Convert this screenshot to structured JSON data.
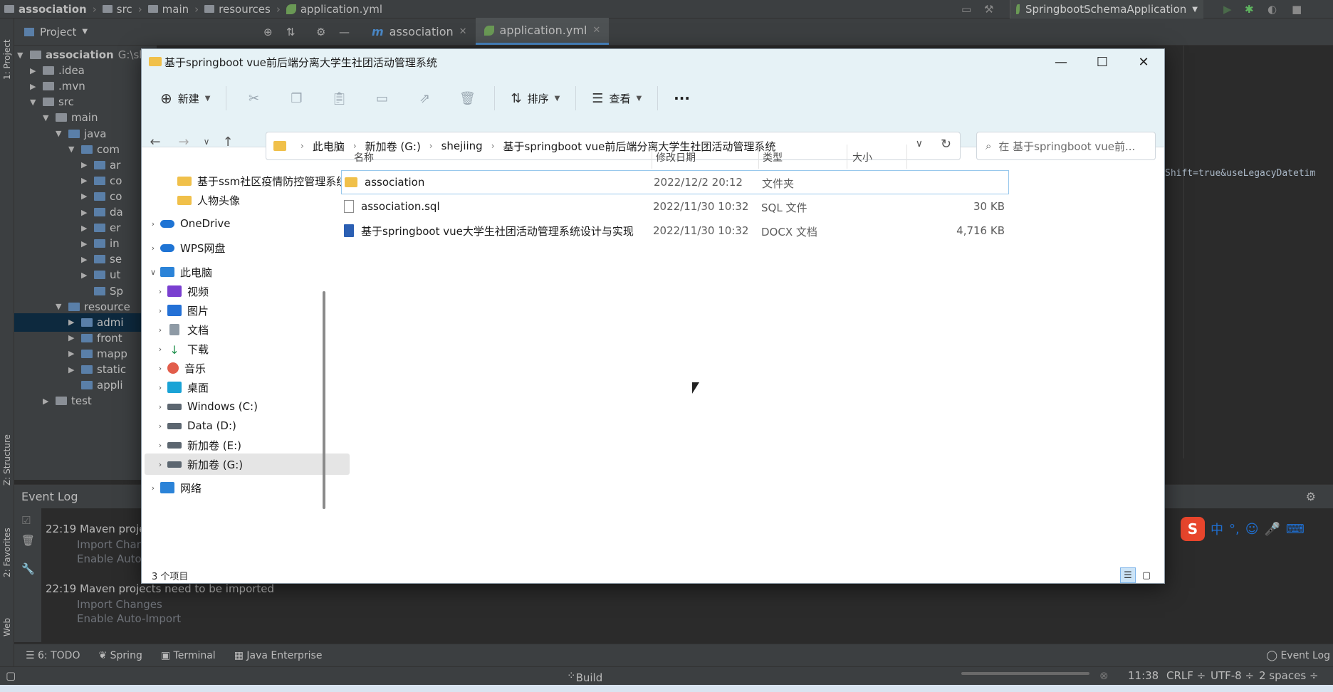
{
  "ide": {
    "breadcrumb": [
      "association",
      "src",
      "main",
      "resources",
      "application.yml"
    ],
    "run_config": "SpringbootSchemaApplication",
    "project_panel_title": "Project",
    "tree": [
      {
        "label": "association",
        "extra": "G:\\sh",
        "indent": 0,
        "tri": "▼"
      },
      {
        "label": ".idea",
        "indent": 1,
        "tri": "▶"
      },
      {
        "label": ".mvn",
        "indent": 1,
        "tri": "▶"
      },
      {
        "label": "src",
        "indent": 1,
        "tri": "▼"
      },
      {
        "label": "main",
        "indent": 2,
        "tri": "▼"
      },
      {
        "label": "java",
        "indent": 3,
        "tri": "▼"
      },
      {
        "label": "com",
        "indent": 4,
        "tri": "▼"
      },
      {
        "label": "ar",
        "indent": 5,
        "tri": "▶"
      },
      {
        "label": "co",
        "indent": 5,
        "tri": "▶"
      },
      {
        "label": "co",
        "indent": 5,
        "tri": "▶"
      },
      {
        "label": "da",
        "indent": 5,
        "tri": "▶"
      },
      {
        "label": "er",
        "indent": 5,
        "tri": "▶"
      },
      {
        "label": "in",
        "indent": 5,
        "tri": "▶"
      },
      {
        "label": "se",
        "indent": 5,
        "tri": "▶"
      },
      {
        "label": "ut",
        "indent": 5,
        "tri": "▶"
      },
      {
        "label": "Sp",
        "indent": 5,
        "tri": ""
      },
      {
        "label": "resource",
        "indent": 3,
        "tri": "▼"
      },
      {
        "label": "admi",
        "indent": 4,
        "tri": "▶",
        "selected": true
      },
      {
        "label": "front",
        "indent": 4,
        "tri": "▶"
      },
      {
        "label": "mapp",
        "indent": 4,
        "tri": "▶"
      },
      {
        "label": "static",
        "indent": 4,
        "tri": "▶"
      },
      {
        "label": "appli",
        "indent": 4,
        "tri": ""
      },
      {
        "label": "test",
        "indent": 2,
        "tri": "▶"
      }
    ],
    "editor_tabs": [
      {
        "label": "association",
        "active": false
      },
      {
        "label": "application.yml",
        "active": true
      }
    ],
    "editor_code_fragment": "Shift=true&useLegacyDatetim",
    "side_tabs": {
      "project": "1: Project",
      "structure": "Z: Structure",
      "favorites": "2: Favorites",
      "web": "Web"
    },
    "event_log_title": "Event Log",
    "event_log": [
      {
        "time": "22:19",
        "message": "Maven proje",
        "links": [
          "Import Chan",
          "Enable Auto"
        ]
      },
      {
        "time": "22:19",
        "message": "Maven projects need to be imported",
        "links": [
          "Import Changes",
          "Enable Auto-Import"
        ]
      }
    ],
    "bottom_tabs": [
      "6: TODO",
      "Spring",
      "Terminal",
      "Java Enterprise"
    ],
    "event_log_tab": "Event Log",
    "status": {
      "build": "Build",
      "position": "11:38",
      "line_sep": "CRLF ÷",
      "encoding": "UTF-8 ÷",
      "indent": "2 spaces ÷"
    },
    "ime": {
      "lang": "中"
    }
  },
  "explorer": {
    "title": "基于springboot vue前后端分离大学生社团活动管理系统",
    "controls": {
      "minimize": "—",
      "maximize": "☐",
      "close": "✕"
    },
    "toolbar": {
      "new_label": "新建",
      "sort_label": "排序",
      "view_label": "查看",
      "more_label": "···"
    },
    "address": [
      "此电脑",
      "新加卷 (G:)",
      "shejiing",
      "基于springboot vue前后端分离大学生社团活动管理系统"
    ],
    "search_placeholder": "在 基于springboot vue前...",
    "nav_items": [
      {
        "label": "基于ssm社区疫情防控管理系统",
        "icon": "folder",
        "chev": ""
      },
      {
        "label": "人物头像",
        "icon": "folder",
        "chev": ""
      },
      {
        "label": "OneDrive",
        "icon": "cloud",
        "chev": ">"
      },
      {
        "label": "WPS网盘",
        "icon": "cloud",
        "chev": ">"
      },
      {
        "label": "此电脑",
        "icon": "pc",
        "chev": "v"
      },
      {
        "label": "视频",
        "icon": "video",
        "chev": ">"
      },
      {
        "label": "图片",
        "icon": "pic",
        "chev": ">"
      },
      {
        "label": "文档",
        "icon": "doc",
        "chev": ">"
      },
      {
        "label": "下载",
        "icon": "dl",
        "chev": ">"
      },
      {
        "label": "音乐",
        "icon": "music",
        "chev": ">"
      },
      {
        "label": "桌面",
        "icon": "desk",
        "chev": ">"
      },
      {
        "label": "Windows (C:)",
        "icon": "drive",
        "chev": ">"
      },
      {
        "label": "Data (D:)",
        "icon": "drive",
        "chev": ">"
      },
      {
        "label": "新加卷 (E:)",
        "icon": "drive",
        "chev": ">"
      },
      {
        "label": "新加卷 (G:)",
        "icon": "drive",
        "chev": ">",
        "selected": true
      },
      {
        "label": "网络",
        "icon": "net",
        "chev": ">"
      }
    ],
    "columns": {
      "name": "名称",
      "date": "修改日期",
      "type": "类型",
      "size": "大小"
    },
    "files": [
      {
        "name": "association",
        "date": "2022/12/2 20:12",
        "type": "文件夹",
        "size": "",
        "icon": "folder",
        "selected": true
      },
      {
        "name": "association.sql",
        "date": "2022/11/30 10:32",
        "type": "SQL 文件",
        "size": "30 KB",
        "icon": "file"
      },
      {
        "name": "基于springboot vue大学生社团活动管理系统设计与实现",
        "date": "2022/11/30 10:32",
        "type": "DOCX 文档",
        "size": "4,716 KB",
        "icon": "docx"
      }
    ],
    "item_count": "3 个项目"
  }
}
